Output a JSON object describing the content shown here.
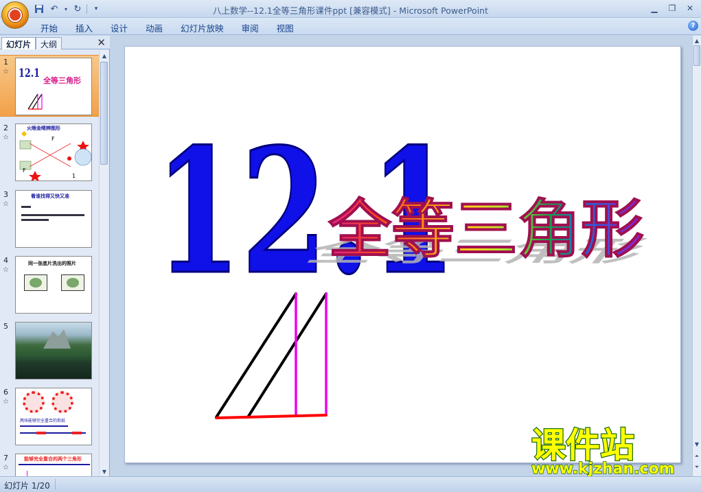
{
  "window": {
    "title": "八上数学--12.1全等三角形课件ppt [兼容模式] - Microsoft PowerPoint"
  },
  "ribbon": {
    "tabs": [
      {
        "label": "开始"
      },
      {
        "label": "插入"
      },
      {
        "label": "设计"
      },
      {
        "label": "动画"
      },
      {
        "label": "幻灯片放映"
      },
      {
        "label": "审阅"
      },
      {
        "label": "视图"
      }
    ]
  },
  "left_pane": {
    "tab_slides": "幻灯片",
    "tab_outline": "大纲",
    "thumbnails": [
      {
        "num": "1",
        "title": "12.1",
        "subtitle": "全等三角形"
      },
      {
        "num": "2",
        "title": "火眼金睛辨图形"
      },
      {
        "num": "3",
        "title": "看谁找得又快又准"
      },
      {
        "num": "4",
        "title": "同一张底片洗出的照片"
      },
      {
        "num": "5"
      },
      {
        "num": "6",
        "text": "两块能够完全重合的剪纸"
      },
      {
        "num": "7",
        "title": "能够完全重合的两个三角形"
      }
    ]
  },
  "slide": {
    "number": "12.1",
    "title": "全等三角形"
  },
  "watermark": {
    "line1": "课件站",
    "line2": "www.kjzhan.com"
  },
  "status": {
    "text": "幻灯片 1/20"
  },
  "colors": {
    "number_blue": "#1010e8",
    "triangle_magenta": "#ee00ee",
    "triangle_red": "#ff0000",
    "selected_thumb": "#f4a853",
    "watermark_yellow": "#ffff00"
  }
}
